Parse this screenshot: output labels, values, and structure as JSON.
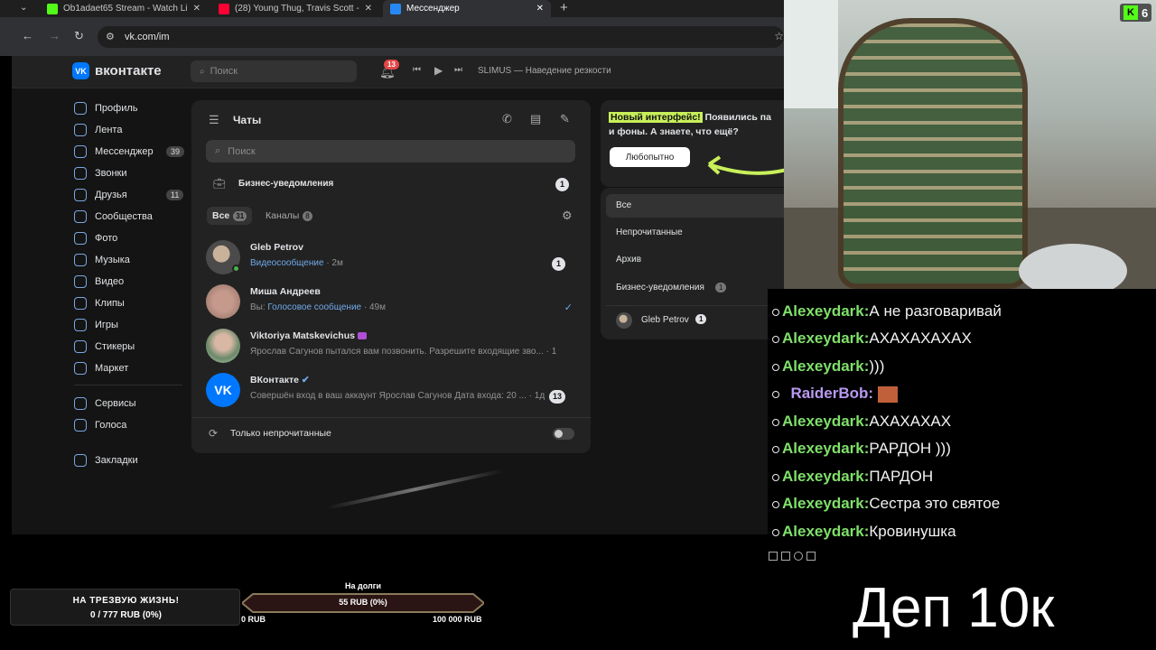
{
  "browser": {
    "tabs": [
      {
        "label": "Ob1adaet65 Stream - Watch Li",
        "color": "#53fc18"
      },
      {
        "label": "(28) Young Thug, Travis Scott -",
        "color": "#ff0033"
      },
      {
        "label": "Мессенджер",
        "color": "#2787f5"
      }
    ],
    "new_tab": "+",
    "url": "vk.com/im"
  },
  "vk": {
    "logo_text": "вконтакте",
    "search_placeholder": "Поиск",
    "notif_count": "13",
    "player_track": "SLIMUS — Наведение резкости",
    "sidebar": [
      {
        "label": "Профиль"
      },
      {
        "label": "Лента"
      },
      {
        "label": "Мессенджер",
        "count": "39"
      },
      {
        "label": "Звонки"
      },
      {
        "label": "Друзья",
        "count": "11"
      },
      {
        "label": "Сообщества"
      },
      {
        "label": "Фото"
      },
      {
        "label": "Музыка"
      },
      {
        "label": "Видео"
      },
      {
        "label": "Клипы"
      },
      {
        "label": "Игры"
      },
      {
        "label": "Стикеры"
      },
      {
        "label": "Маркет"
      },
      {
        "label": "Сервисы"
      },
      {
        "label": "Голоса"
      },
      {
        "label": "Закладки"
      }
    ],
    "chats": {
      "title": "Чаты",
      "search_placeholder": "Поиск",
      "business": {
        "label": "Бизнес-уведомления",
        "count": "1"
      },
      "tab_all": "Все",
      "tab_all_count": "31",
      "tab_channels": "Каналы",
      "tab_channels_count": "8",
      "items": [
        {
          "name": "Gleb Petrov",
          "prefix": "",
          "highlight": "Видеосообщение",
          "text": "",
          "time": "· 2м",
          "badge": "1"
        },
        {
          "name": "Миша Андреев",
          "prefix": "Вы: ",
          "highlight": "Голосовое сообщение",
          "text": "",
          "time": "· 49м",
          "badge": "✓"
        },
        {
          "name": "Viktoriya Matskevichus",
          "prefix": "",
          "highlight": "",
          "text": "Ярослав Сагунов пытался вам позвонить. Разрешите входящие зво...",
          "time": "· 1",
          "badge": ""
        },
        {
          "name": "ВКонтакте",
          "prefix": "",
          "highlight": "",
          "text": "Совершён вход в ваш аккаунт Ярослав Сагунов Дата входа: 20 ...",
          "time": "· 1д",
          "badge": "13"
        }
      ],
      "unread_only": "Только непрочитанные"
    },
    "promo": {
      "highlight": "Новый интерфейс!",
      "text1": " Появились па",
      "text2": "и фоны. А знаете, что ещё?",
      "button": "Любопытно"
    },
    "filters": {
      "all": "Все",
      "unread": "Непрочитанные",
      "archive": "Архив",
      "business": "Бизнес-уведомления",
      "business_count": "1",
      "pinned_name": "Gleb Petrov",
      "pinned_count": "1"
    }
  },
  "stream": {
    "kick_viewers": "6",
    "chat": [
      {
        "user": "Alexeydark:",
        "text": "А не разговаривай"
      },
      {
        "user": "Alexeydark:",
        "text": "АХАХАХАХАХ"
      },
      {
        "user": "Alexeydark:",
        "text": ")))"
      },
      {
        "user": "RaiderBob:",
        "text": ""
      },
      {
        "user": "Alexeydark:",
        "text": "АХАХАХАХ"
      },
      {
        "user": "Alexeydark:",
        "text": "РАРДОН )))"
      },
      {
        "user": "Alexeydark:",
        "text": "ПАРДОН"
      },
      {
        "user": "Alexeydark:",
        "text": "Сестра это святое"
      },
      {
        "user": "Alexeydark:",
        "text": "Кровинушка"
      }
    ],
    "goal1_title": "НА ТРЕЗВУЮ ЖИЗНЬ!",
    "goal1_value": "0 / 777 RUB (0%)",
    "debt_title": "На долги",
    "debt_value": "55 RUB (0%)",
    "debt_fraction": 0.0,
    "debt_min": "0 RUB",
    "debt_max": "100 000 RUB",
    "big_text": "Деп 10к"
  }
}
